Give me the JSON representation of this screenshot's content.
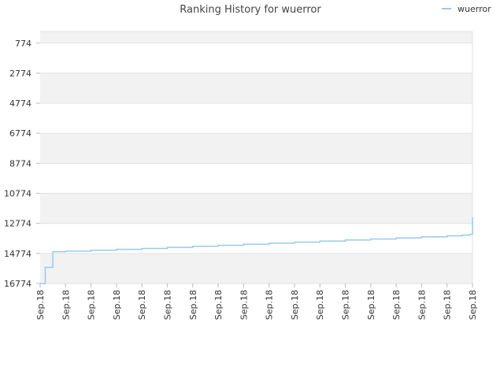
{
  "chart_data": {
    "type": "line",
    "title": "Ranking History for wuerror",
    "xlabel": "",
    "ylabel": "",
    "y_reversed": true,
    "ylim": [
      16774,
      0
    ],
    "y_ticks": [
      774,
      2774,
      4774,
      6774,
      8774,
      10774,
      12774,
      14774,
      16774
    ],
    "y_tick_labels": [
      "774",
      "2774",
      "4774",
      "6774",
      "8774",
      "10774",
      "12774",
      "14774",
      "16774"
    ],
    "x_tick_labels": [
      "Sep.18",
      "Sep.18",
      "Sep.18",
      "Sep.18",
      "Sep.18",
      "Sep.18",
      "Sep.18",
      "Sep.18",
      "Sep.18",
      "Sep.18",
      "Sep.18",
      "Sep.18",
      "Sep.18",
      "Sep.18",
      "Sep.18",
      "Sep.18",
      "Sep.18",
      "Sep.18"
    ],
    "grid": true,
    "band_colors": [
      "#f2f2f2",
      "#ffffff"
    ],
    "legend_position": "top-right",
    "series": [
      {
        "name": "wuerror",
        "color": "#99c9ee",
        "x": [
          0.0,
          0.2,
          0.5,
          1.0,
          2.0,
          3.0,
          4.0,
          5.0,
          6.0,
          7.0,
          8.0,
          9.0,
          10.0,
          11.0,
          12.0,
          13.0,
          14.0,
          15.0,
          16.0,
          16.6,
          16.9,
          17.0
        ],
        "y": [
          16774,
          15700,
          14660,
          14620,
          14560,
          14500,
          14440,
          14370,
          14300,
          14230,
          14160,
          14090,
          14020,
          13950,
          13880,
          13810,
          13740,
          13670,
          13600,
          13560,
          13500,
          12360
        ]
      }
    ]
  }
}
